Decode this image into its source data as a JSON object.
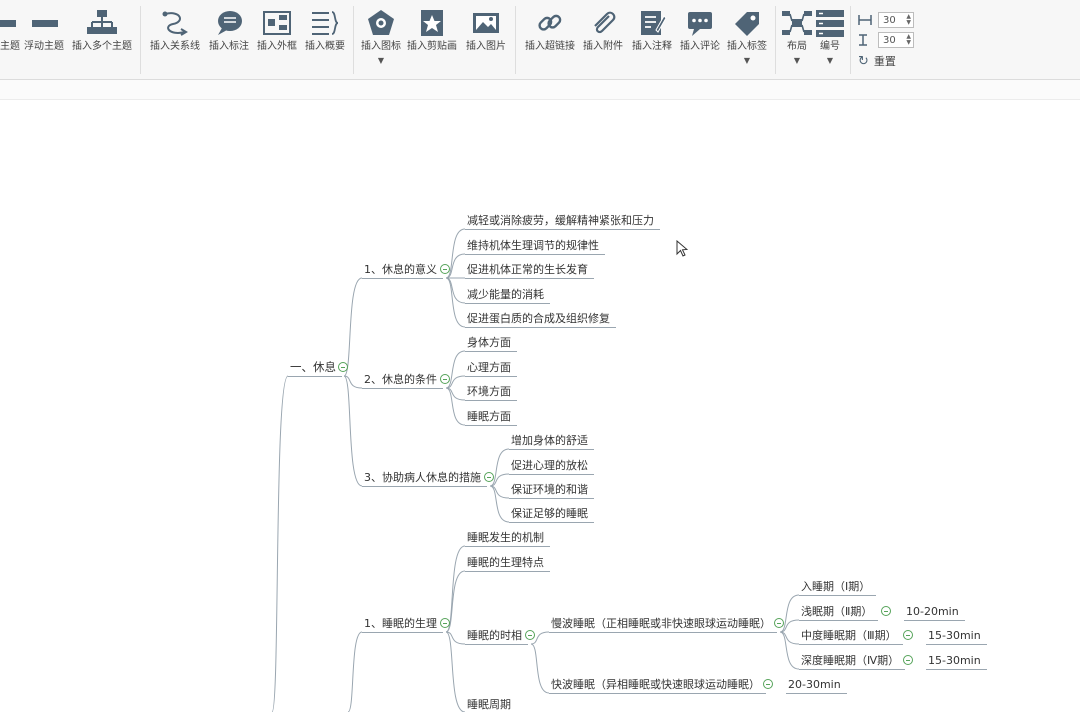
{
  "toolbar": {
    "buttons": [
      {
        "label": "主题",
        "icon": "subtopic-icon"
      },
      {
        "label": "浮动主题",
        "icon": "floating-topic-icon"
      },
      {
        "label": "插入多个主题",
        "icon": "multiple-topics-icon"
      },
      {
        "label": "插入关系线",
        "icon": "relationship-icon"
      },
      {
        "label": "插入标注",
        "icon": "callout-icon"
      },
      {
        "label": "插入外框",
        "icon": "boundary-icon"
      },
      {
        "label": "插入概要",
        "icon": "summary-icon"
      },
      {
        "label": "插入图标",
        "icon": "insert-icon-icon"
      },
      {
        "label": "插入剪贴画",
        "icon": "clipart-icon"
      },
      {
        "label": "插入图片",
        "icon": "image-icon"
      },
      {
        "label": "插入超链接",
        "icon": "hyperlink-icon"
      },
      {
        "label": "插入附件",
        "icon": "attachment-icon"
      },
      {
        "label": "插入注释",
        "icon": "note-icon"
      },
      {
        "label": "插入评论",
        "icon": "comment-icon"
      },
      {
        "label": "插入标签",
        "icon": "label-icon"
      },
      {
        "label": "布局",
        "icon": "layout-icon"
      },
      {
        "label": "编号",
        "icon": "numbering-icon"
      }
    ],
    "spacing_h": "30",
    "spacing_v": "30",
    "reset_label": "重置"
  },
  "mindmap": {
    "n1": "一、休息",
    "n2": "1、休息的意义",
    "n3": "减轻或消除疲劳，缓解精神紧张和压力",
    "n4": "维持机体生理调节的规律性",
    "n5": "促进机体正常的生长发育",
    "n6": "减少能量的消耗",
    "n7": "促进蛋白质的合成及组织修复",
    "n8": "2、休息的条件",
    "n9": "身体方面",
    "n10": "心理方面",
    "n11": "环境方面",
    "n12": "睡眠方面",
    "n13": "3、协助病人休息的措施",
    "n14": "增加身体的舒适",
    "n15": "促进心理的放松",
    "n16": "保证环境的和谐",
    "n17": "保证足够的睡眠",
    "n18": "1、睡眠的生理",
    "n19": "睡眠发生的机制",
    "n20": "睡眠的生理特点",
    "n21": "睡眠的时相",
    "n22": "慢波睡眠（正相睡眠或非快速眼球运动睡眠）",
    "n23": "入睡期（Ⅰ期）",
    "n24": "浅眠期（Ⅱ期）",
    "n25": "10-20min",
    "n26": "中度睡眠期（Ⅲ期）",
    "n27": "15-30min",
    "n28": "深度睡眠期（Ⅳ期）",
    "n29": "15-30min",
    "n30": "快波睡眠（异相睡眠或快速眼球运动睡眠）",
    "n31": "20-30min",
    "n32": "睡眠周期"
  },
  "colors": {
    "branch": "#9aa6b0",
    "toggle": "#56a35a",
    "icon": "#4f6476"
  }
}
